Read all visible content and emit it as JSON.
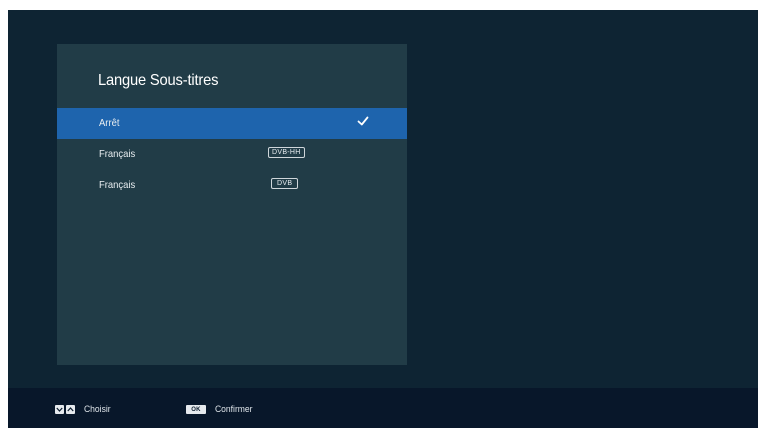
{
  "panel": {
    "title": "Langue Sous-titres",
    "items": [
      {
        "label": "Arrêt",
        "tag": "",
        "selected": true,
        "checked": true
      },
      {
        "label": "Français",
        "tag": "DVB-HH",
        "selected": false,
        "checked": false
      },
      {
        "label": "Français",
        "tag": "DVB",
        "selected": false,
        "checked": false
      }
    ]
  },
  "footer": {
    "choose_label": "Choisir",
    "ok_key": "OK",
    "confirm_label": "Confirmer"
  },
  "colors": {
    "background": "#0e2433",
    "panel": "#213c47",
    "selection": "#1e64ad",
    "footer": "#08172a"
  },
  "icons": {
    "check": "check-icon",
    "down": "chevron-down-icon",
    "up": "chevron-up-icon"
  }
}
